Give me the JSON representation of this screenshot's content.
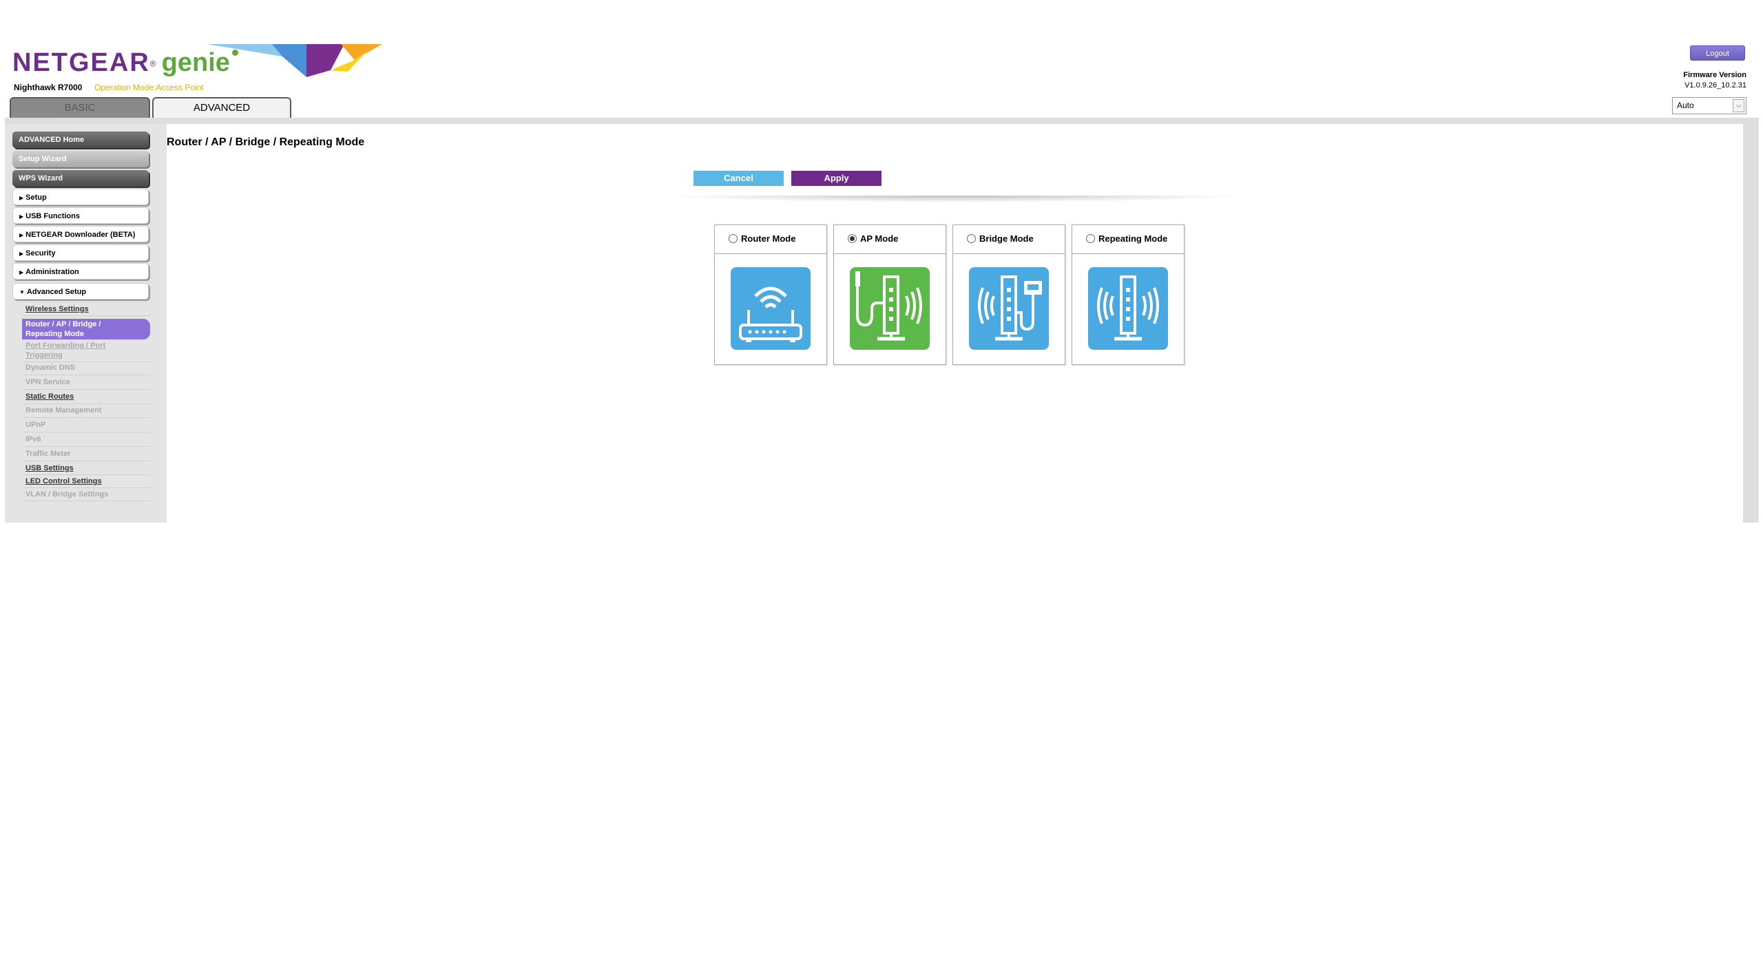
{
  "header": {
    "brand": "NETGEAR",
    "brand_sub": "genie",
    "model": "Nighthawk R7000",
    "operation_mode": "Operation Mode:Access Point",
    "logout_label": "Logout",
    "firmware_label": "Firmware Version",
    "firmware_value": "V1.0.9.26_10.2.31",
    "language_selected": "Auto"
  },
  "tabs": [
    {
      "label": "BASIC",
      "active": false
    },
    {
      "label": "ADVANCED",
      "active": true
    }
  ],
  "sidebar": {
    "top_buttons": [
      "ADVANCED Home",
      "Setup Wizard",
      "WPS Wizard"
    ],
    "menu": [
      "Setup",
      "USB Functions",
      "NETGEAR Downloader (BETA)",
      "Security",
      "Administration",
      "Advanced Setup"
    ],
    "submenu": [
      {
        "label": "Wireless Settings",
        "state": "enabled"
      },
      {
        "label": "Router / AP / Bridge / Repeating Mode",
        "state": "selected",
        "line1": "Router / AP / Bridge /",
        "line2": "Repeating Mode"
      },
      {
        "label": "Port Forwarding / Port Triggering",
        "state": "disabled",
        "line1": "Port Forwarding / Port",
        "line2": "Triggering"
      },
      {
        "label": "Dynamic DNS",
        "state": "disabled"
      },
      {
        "label": "VPN Service",
        "state": "disabled"
      },
      {
        "label": "Static Routes",
        "state": "enabled"
      },
      {
        "label": "Remote Management",
        "state": "disabled"
      },
      {
        "label": "UPnP",
        "state": "disabled"
      },
      {
        "label": "IPv6",
        "state": "disabled"
      },
      {
        "label": "Traffic Meter",
        "state": "disabled"
      },
      {
        "label": "USB Settings",
        "state": "enabled"
      },
      {
        "label": "LED Control Settings",
        "state": "enabled"
      },
      {
        "label": "VLAN / Bridge Settings",
        "state": "disabled"
      }
    ]
  },
  "main": {
    "title": "Router / AP / Bridge / Repeating Mode",
    "cancel_label": "Cancel",
    "apply_label": "Apply",
    "modes": [
      {
        "label": "Router Mode",
        "selected": false,
        "icon": "router-icon",
        "color": "#4aa9e0"
      },
      {
        "label": "AP Mode",
        "selected": true,
        "icon": "access-point-icon",
        "color": "#5cb848"
      },
      {
        "label": "Bridge Mode",
        "selected": false,
        "icon": "bridge-icon",
        "color": "#4aa9e0"
      },
      {
        "label": "Repeating Mode",
        "selected": false,
        "icon": "repeater-icon",
        "color": "#4aa9e0"
      }
    ]
  },
  "colors": {
    "brand_purple": "#6b2f8a",
    "brand_green": "#5fa83a",
    "selected_nav": "#8a6fd8",
    "cancel_blue": "#5bb7e6"
  }
}
